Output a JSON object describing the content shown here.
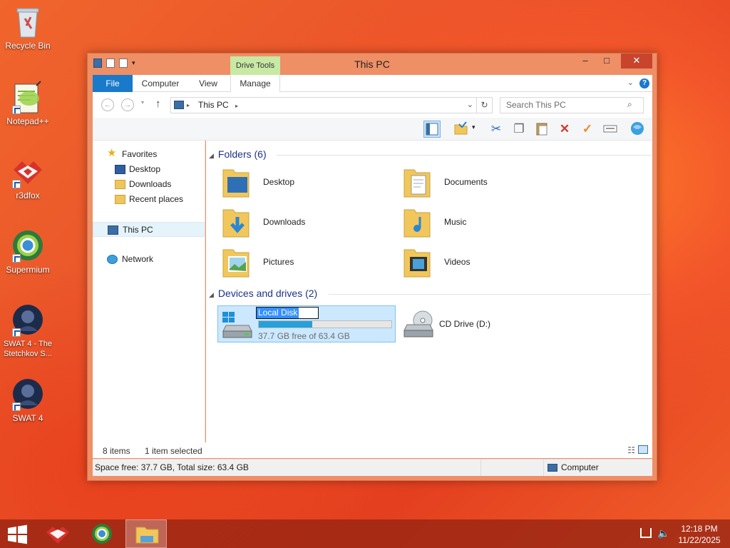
{
  "desktop": {
    "icons": [
      {
        "label": "Recycle Bin"
      },
      {
        "label": "Notepad++"
      },
      {
        "label": "r3dfox"
      },
      {
        "label": "Supermium"
      },
      {
        "label": "SWAT 4 - The Stetchkov S..."
      },
      {
        "label": "SWAT 4"
      }
    ]
  },
  "window": {
    "title": "This PC",
    "context_tab": "Drive Tools",
    "tabs": [
      "File",
      "Computer",
      "View",
      "Manage"
    ],
    "help": "?",
    "address": {
      "crumb": "This PC",
      "search_placeholder": "Search This PC"
    },
    "nav": {
      "favorites": "Favorites",
      "fav_items": [
        "Desktop",
        "Downloads",
        "Recent places"
      ],
      "this_pc": "This PC",
      "network": "Network"
    },
    "folders_header": "Folders (6)",
    "folders": [
      "Desktop",
      "Documents",
      "Downloads",
      "Music",
      "Pictures",
      "Videos"
    ],
    "drives_header": "Devices and drives (2)",
    "drives": [
      {
        "name": "Local Disk",
        "free_text": "37.7 GB free of 63.4 GB",
        "used_fraction": 0.405
      },
      {
        "name": "CD Drive (D:)"
      }
    ],
    "status": {
      "items": "8 items",
      "selected": "1 item selected"
    },
    "details": {
      "space": "Space free: 37.7 GB, Total size: 63.4 GB",
      "location": "Computer"
    }
  },
  "taskbar": {
    "time": "12:18 PM",
    "date": "11/22/2025"
  },
  "colors": {
    "accent": "#1979ca",
    "selection": "#cce8ff",
    "drive_bar": "#26a0da",
    "drive_tools": "#c7e9a4"
  }
}
